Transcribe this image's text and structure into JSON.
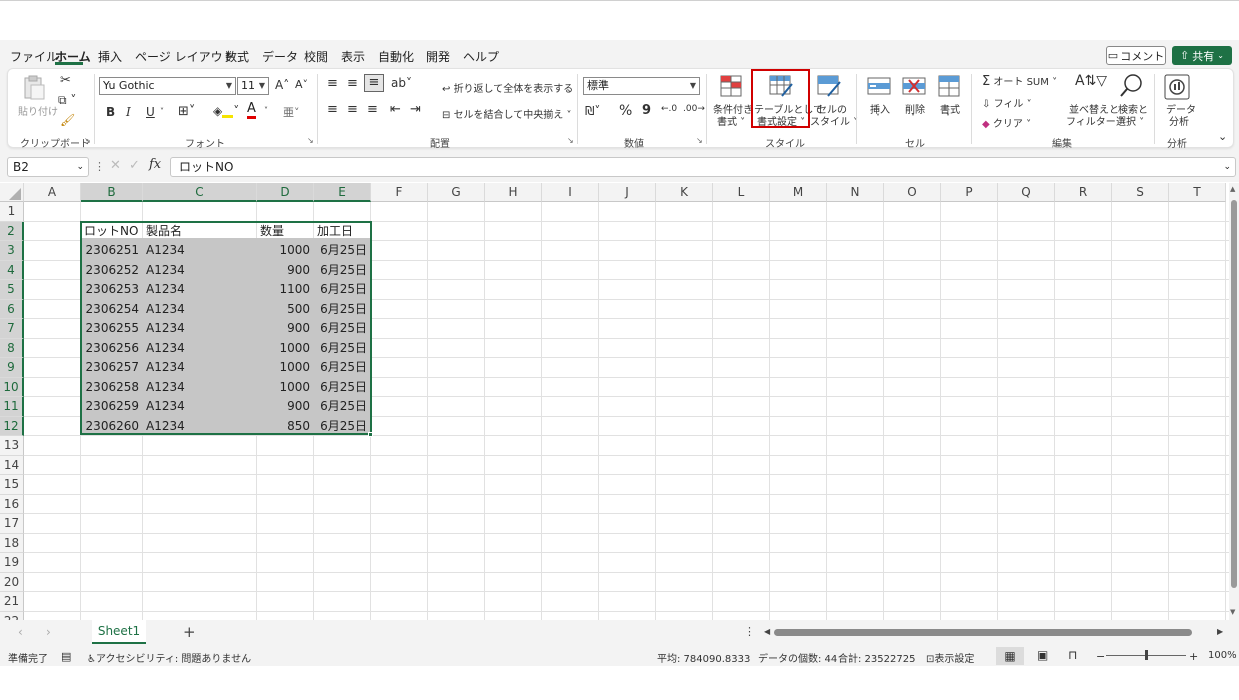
{
  "menu": {
    "items": [
      "ファイル",
      "ホーム",
      "挿入",
      "ページ レイアウト",
      "数式",
      "データ",
      "校閲",
      "表示",
      "自動化",
      "開発",
      "ヘルプ"
    ],
    "active": "ホーム",
    "comment_label": "コメント",
    "share_label": "共有"
  },
  "ribbon": {
    "clipboard": {
      "paste_label": "貼り付け",
      "group_label": "クリップボード"
    },
    "font": {
      "font_name": "Yu Gothic",
      "font_size": "11",
      "bold": "B",
      "italic": "I",
      "underline": "U",
      "grow": "A^",
      "shrink": "Aˇ",
      "group_label": "フォント"
    },
    "alignment": {
      "wrap_label": "折り返して全体を表示する",
      "merge_label": "セルを結合して中央揃え",
      "group_label": "配置"
    },
    "number": {
      "format_value": "標準",
      "percent": "%",
      "comma": "9",
      "group_label": "数値"
    },
    "styles": {
      "conditional_line1": "条件付き",
      "conditional_line2": "書式",
      "table_line1": "テーブルとして",
      "table_line2": "書式設定",
      "cell_line1": "セルの",
      "cell_line2": "スタイル",
      "group_label": "スタイル"
    },
    "cells": {
      "insert_label": "挿入",
      "delete_label": "削除",
      "format_label": "書式",
      "group_label": "セル"
    },
    "editing": {
      "autosum_label": "オート SUM",
      "fill_label": "フィル",
      "clear_label": "クリア",
      "sort_line1": "並べ替えと",
      "sort_line2": "フィルター",
      "find_line1": "検索と",
      "find_line2": "選択",
      "group_label": "編集"
    },
    "analysis": {
      "analyze_line1": "データ",
      "analyze_line2": "分析",
      "group_label": "分析"
    }
  },
  "formula_bar": {
    "name_box": "B2",
    "fx": "fx",
    "content": "ロットNO"
  },
  "grid": {
    "columns": [
      "A",
      "B",
      "C",
      "D",
      "E",
      "F",
      "G",
      "H",
      "I",
      "J",
      "K",
      "L",
      "M",
      "N",
      "O",
      "P",
      "Q",
      "R",
      "S",
      "T"
    ],
    "rows": [
      "1",
      "2",
      "3",
      "4",
      "5",
      "6",
      "7",
      "8",
      "9",
      "10",
      "11",
      "12",
      "13",
      "14",
      "15",
      "16",
      "17",
      "18",
      "19",
      "20",
      "21",
      "22"
    ],
    "headers": [
      "ロットNO",
      "製品名",
      "数量",
      "加工日"
    ],
    "data": [
      [
        "2306251",
        "A1234",
        "1000",
        "6月25日"
      ],
      [
        "2306252",
        "A1234",
        "900",
        "6月25日"
      ],
      [
        "2306253",
        "A1234",
        "1100",
        "6月25日"
      ],
      [
        "2306254",
        "A1234",
        "500",
        "6月25日"
      ],
      [
        "2306255",
        "A1234",
        "900",
        "6月25日"
      ],
      [
        "2306256",
        "A1234",
        "1000",
        "6月25日"
      ],
      [
        "2306257",
        "A1234",
        "1000",
        "6月25日"
      ],
      [
        "2306258",
        "A1234",
        "1000",
        "6月25日"
      ],
      [
        "2306259",
        "A1234",
        "900",
        "6月25日"
      ],
      [
        "2306260",
        "A1234",
        "850",
        "6月25日"
      ]
    ]
  },
  "sheets": {
    "tabs": [
      "Sheet1"
    ],
    "add": "+"
  },
  "status": {
    "ready": "準備完了",
    "accessibility": "アクセシビリティ: 問題ありません",
    "average": "平均: 784090.8333",
    "count": "データの個数: 44",
    "sum": "合計: 23522725",
    "display_settings": "表示設定",
    "zoom": "100%",
    "zoom_minus": "−",
    "zoom_plus": "+"
  },
  "colors": {
    "accent": "#1e7145",
    "highlight": "#d00000",
    "selection_fill": "#c6c6c6"
  }
}
